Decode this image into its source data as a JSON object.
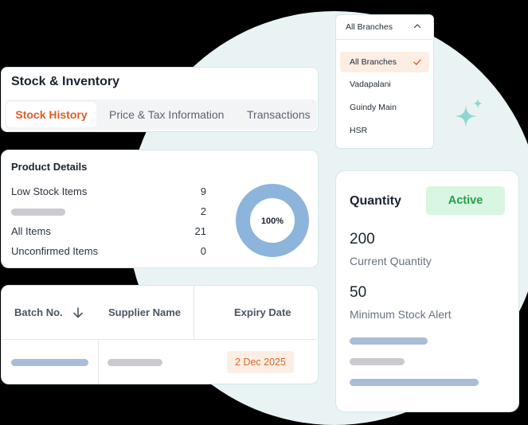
{
  "stock": {
    "title": "Stock & Inventory",
    "tabs": [
      {
        "label": "Stock History",
        "active": true
      },
      {
        "label": "Price & Tax Information",
        "active": false
      },
      {
        "label": "Transactions",
        "active": false
      }
    ]
  },
  "product": {
    "title": "Product Details",
    "rows": [
      {
        "label": "Low Stock Items",
        "value": "9"
      },
      {
        "label": "",
        "value": "2"
      },
      {
        "label": "All Items",
        "value": "21"
      },
      {
        "label": "Unconfirmed Items",
        "value": "0"
      }
    ],
    "donut_label": "100%",
    "donut_fraction": 1.0
  },
  "batch": {
    "headers": [
      "Batch No.",
      "Supplier Name",
      "Expiry Date"
    ],
    "expiry": "2 Dec 2025"
  },
  "branches": {
    "selected": "All Branches",
    "options": [
      "All Branches",
      "Vadapalani",
      "Guindy Main",
      "HSR"
    ]
  },
  "quantity": {
    "title": "Quantity",
    "status": "Active",
    "current_value": "200",
    "current_label": "Current Quantity",
    "min_value": "50",
    "min_label": "Minimum Stock Alert"
  },
  "colors": {
    "accent": "#e35b22",
    "active_green": "#24a148",
    "bar_blue": "#a9bcd8",
    "bar_gray": "#c9cbcf",
    "donut": "#8db4db"
  },
  "icons": [
    "sort-down-icon",
    "chevron-up-icon",
    "check-icon",
    "sparkle-icon"
  ]
}
